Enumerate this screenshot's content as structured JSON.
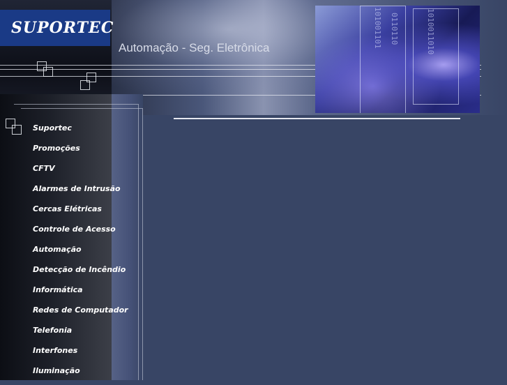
{
  "header": {
    "logo_text": "SUPORTEC",
    "tagline": "Automação - Seg. Eletrônica",
    "photo_bits": [
      "101001101",
      "0110110",
      "1010011010"
    ]
  },
  "sidebar": {
    "items": [
      {
        "label": "Suportec"
      },
      {
        "label": "Promoções"
      },
      {
        "label": "CFTV"
      },
      {
        "label": "Alarmes de Intrusão"
      },
      {
        "label": "Cercas Elétricas"
      },
      {
        "label": "Controle de Acesso"
      },
      {
        "label": "Automação"
      },
      {
        "label": "Detecção de Incêndio"
      },
      {
        "label": "Informática"
      },
      {
        "label": "Redes de Computador"
      },
      {
        "label": "Telefonia"
      },
      {
        "label": "Interfones"
      },
      {
        "label": "Iluminação"
      }
    ]
  },
  "colors": {
    "background": "#384565",
    "logo_bg": "#1a3a86",
    "text": "#ffffff"
  }
}
